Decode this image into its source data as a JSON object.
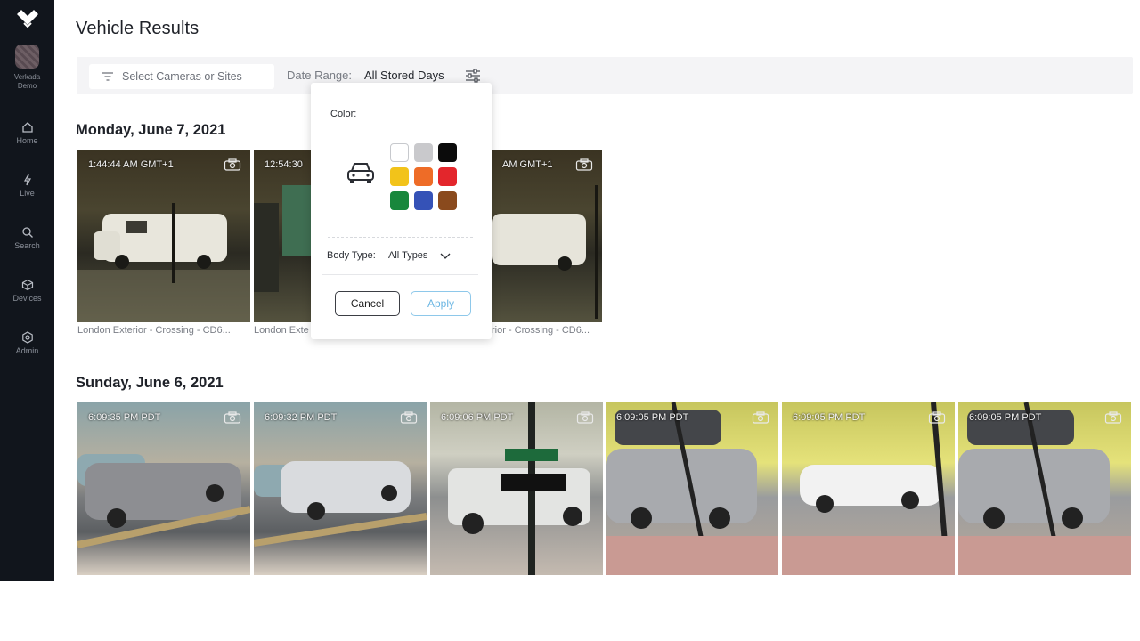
{
  "sidebar": {
    "org_line1": "Verkada",
    "org_line2": "Demo",
    "items": [
      {
        "label": "Home",
        "icon": "home-icon"
      },
      {
        "label": "Live",
        "icon": "live-icon"
      },
      {
        "label": "Search",
        "icon": "search-icon"
      },
      {
        "label": "Devices",
        "icon": "devices-icon"
      },
      {
        "label": "Admin",
        "icon": "admin-icon"
      }
    ]
  },
  "header": {
    "title": "Vehicle Results"
  },
  "filters": {
    "camera_placeholder": "Select Cameras or Sites",
    "date_range_label": "Date Range:",
    "date_range_value": "All Stored Days"
  },
  "popover": {
    "color_label": "Color:",
    "colors": [
      {
        "name": "white",
        "hex": "#ffffff"
      },
      {
        "name": "silver",
        "hex": "#c9c9cc"
      },
      {
        "name": "black",
        "hex": "#0b0b0b"
      },
      {
        "name": "yellow",
        "hex": "#f2c31a"
      },
      {
        "name": "orange",
        "hex": "#ee6c27"
      },
      {
        "name": "red",
        "hex": "#e3262c"
      },
      {
        "name": "green",
        "hex": "#18873c"
      },
      {
        "name": "blue",
        "hex": "#3552b7"
      },
      {
        "name": "brown",
        "hex": "#8a4a1d"
      }
    ],
    "body_type_label": "Body Type:",
    "body_type_value": "All Types",
    "cancel_label": "Cancel",
    "apply_label": "Apply"
  },
  "groups": [
    {
      "date": "Monday, June 7, 2021",
      "cards": [
        {
          "time": "1:44:44 AM GMT+1",
          "caption": "London Exterior - Crossing - CD6..."
        },
        {
          "time": "12:54:30",
          "caption": "London Exte"
        },
        {
          "time": "AM GMT+1",
          "caption": "rior - Crossing - CD6..."
        }
      ]
    },
    {
      "date": "Sunday, June 6, 2021",
      "cards": [
        {
          "time": "6:09:35 PM PDT",
          "caption": ""
        },
        {
          "time": "6:09:32 PM PDT",
          "caption": ""
        },
        {
          "time": "6:09:06 PM PDT",
          "caption": ""
        },
        {
          "time": "6:09:05 PM PDT",
          "caption": ""
        },
        {
          "time": "6:09:05 PM PDT",
          "caption": ""
        },
        {
          "time": "6:09:05 PM PDT",
          "caption": ""
        }
      ]
    }
  ]
}
